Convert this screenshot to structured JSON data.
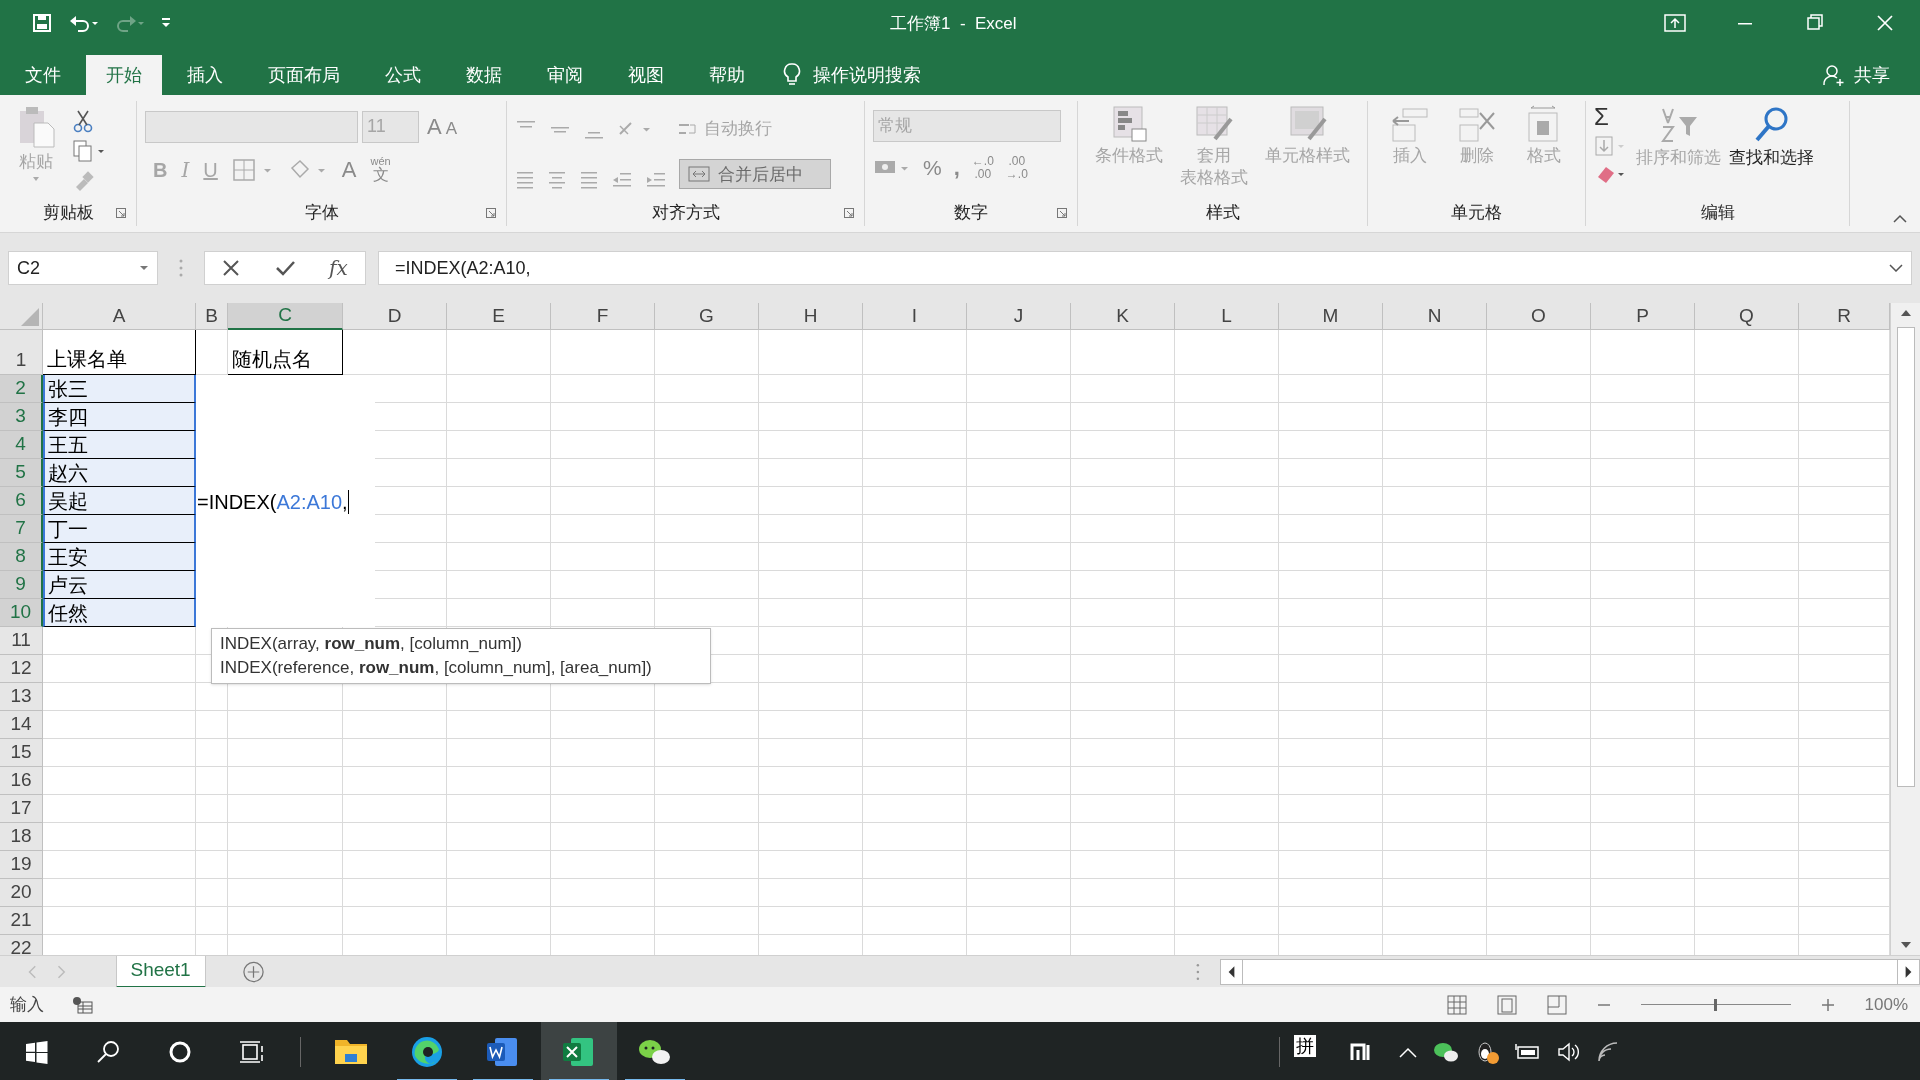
{
  "window": {
    "title": "工作簿1  -  Excel"
  },
  "ribbon_tabs": [
    {
      "label": "文件",
      "selected": false
    },
    {
      "label": "开始",
      "selected": true
    },
    {
      "label": "插入",
      "selected": false
    },
    {
      "label": "页面布局",
      "selected": false
    },
    {
      "label": "公式",
      "selected": false
    },
    {
      "label": "数据",
      "selected": false
    },
    {
      "label": "审阅",
      "selected": false
    },
    {
      "label": "视图",
      "selected": false
    },
    {
      "label": "帮助",
      "selected": false
    }
  ],
  "tell_me": "操作说明搜索",
  "share": "共享",
  "ribbon": {
    "clipboard": {
      "label": "剪贴板",
      "paste": {
        "label": "粘贴",
        "disabled": true
      }
    },
    "font": {
      "label": "字体",
      "font_size": "11",
      "grow": "A",
      "shrink": "A",
      "bold": "B",
      "italic": "I",
      "underline": "U",
      "font_color": "A",
      "phonetic_top": "wén",
      "phonetic": "文"
    },
    "alignment": {
      "label": "对齐方式",
      "wrap_text": {
        "label": "自动换行",
        "disabled": true
      },
      "merge": {
        "label": "合并后居中",
        "disabled": true
      }
    },
    "number": {
      "label": "数字",
      "format": "常规",
      "percent": "%",
      "comma": ",",
      "increase_decimal": [
        "←.0",
        ".00"
      ],
      "decrease_decimal": [
        ".00",
        "→.0"
      ]
    },
    "styles": {
      "label": "样式",
      "buttons": [
        {
          "label_lines": [
            "条件格式"
          ],
          "kind": "conditional",
          "disabled": true
        },
        {
          "label_lines": [
            "套用",
            "表格格式"
          ],
          "kind": "table",
          "disabled": true
        },
        {
          "label_lines": [
            "单元格样式"
          ],
          "kind": "cellstyle",
          "disabled": true
        }
      ]
    },
    "cells": {
      "label": "单元格",
      "buttons": [
        {
          "label_lines": [
            "插入"
          ],
          "kind": "insert",
          "disabled": true
        },
        {
          "label_lines": [
            "删除"
          ],
          "kind": "delete",
          "disabled": true
        },
        {
          "label_lines": [
            "格式"
          ],
          "kind": "format",
          "disabled": true
        }
      ]
    },
    "editing": {
      "label": "编辑",
      "sum": "Σ",
      "sort": {
        "label": "排序和筛选",
        "disabled": true
      },
      "find": {
        "label": "查找和选择",
        "disabled": false
      }
    }
  },
  "formula_bar": {
    "name_box": "C2",
    "fx": "fx",
    "formula": "=INDEX(A2:A10,"
  },
  "sheet": {
    "columns": [
      {
        "label": "A",
        "selected": false
      },
      {
        "label": "B",
        "selected": false
      },
      {
        "label": "C",
        "selected": true
      },
      {
        "label": "D",
        "selected": false
      },
      {
        "label": "E",
        "selected": false
      },
      {
        "label": "F",
        "selected": false
      },
      {
        "label": "G",
        "selected": false
      },
      {
        "label": "H",
        "selected": false
      },
      {
        "label": "I",
        "selected": false
      },
      {
        "label": "J",
        "selected": false
      },
      {
        "label": "K",
        "selected": false
      },
      {
        "label": "L",
        "selected": false
      },
      {
        "label": "M",
        "selected": false
      },
      {
        "label": "N",
        "selected": false
      },
      {
        "label": "O",
        "selected": false
      },
      {
        "label": "P",
        "selected": false
      },
      {
        "label": "Q",
        "selected": false
      },
      {
        "label": "R",
        "selected": false
      }
    ],
    "rows": [
      {
        "label": "1",
        "selected": false,
        "cells": {
          "A": {
            "text": "上课名单",
            "highlighted": false
          },
          "C": {
            "text": "随机点名",
            "highlighted": false
          }
        }
      },
      {
        "label": "2",
        "selected": true,
        "cells": {
          "A": {
            "text": "张三",
            "highlighted": true
          }
        }
      },
      {
        "label": "3",
        "selected": true,
        "cells": {
          "A": {
            "text": "李四",
            "highlighted": true
          }
        }
      },
      {
        "label": "4",
        "selected": true,
        "cells": {
          "A": {
            "text": "王五",
            "highlighted": true
          }
        }
      },
      {
        "label": "5",
        "selected": true,
        "cells": {
          "A": {
            "text": "赵六",
            "highlighted": true
          }
        }
      },
      {
        "label": "6",
        "selected": true,
        "cells": {
          "A": {
            "text": "吴起",
            "highlighted": true
          }
        }
      },
      {
        "label": "7",
        "selected": true,
        "cells": {
          "A": {
            "text": "丁一",
            "highlighted": true
          }
        }
      },
      {
        "label": "8",
        "selected": true,
        "cells": {
          "A": {
            "text": "王安",
            "highlighted": true
          }
        }
      },
      {
        "label": "9",
        "selected": true,
        "cells": {
          "A": {
            "text": "卢云",
            "highlighted": true
          }
        }
      },
      {
        "label": "10",
        "selected": true,
        "cells": {
          "A": {
            "text": "任然",
            "highlighted": true
          }
        }
      },
      {
        "label": "11",
        "selected": false
      },
      {
        "label": "12",
        "selected": false
      },
      {
        "label": "13",
        "selected": false
      },
      {
        "label": "14",
        "selected": false
      },
      {
        "label": "15",
        "selected": false
      },
      {
        "label": "16",
        "selected": false
      },
      {
        "label": "17",
        "selected": false
      },
      {
        "label": "18",
        "selected": false
      },
      {
        "label": "19",
        "selected": false
      },
      {
        "label": "20",
        "selected": false
      },
      {
        "label": "21",
        "selected": false
      },
      {
        "label": "22",
        "selected": false
      }
    ],
    "editor": [
      {
        "text": "=INDEX(",
        "kind": "plain"
      },
      {
        "text": "A2:A10",
        "kind": "reference"
      },
      {
        "text": ",",
        "kind": "plain"
      }
    ],
    "tooltip": [
      "INDEX(array, **row_num**, [column_num])",
      "INDEX(reference, **row_num**, [column_num], [area_num])"
    ]
  },
  "sheet_tabs": [
    {
      "label": "Sheet1",
      "selected": true
    }
  ],
  "status_bar": {
    "mode": "输入",
    "zoom_slider": {
      "level": 0.5
    },
    "zoom": "100%"
  },
  "taskbar": {
    "apps": [
      {
        "kind": "explorer",
        "running": false,
        "active": false
      },
      {
        "kind": "edge",
        "running": true,
        "active": false
      },
      {
        "kind": "word",
        "running": true,
        "active": false
      },
      {
        "kind": "excel",
        "running": true,
        "active": true
      },
      {
        "kind": "wechat",
        "running": true,
        "active": false
      }
    ],
    "ime": "拼"
  }
}
